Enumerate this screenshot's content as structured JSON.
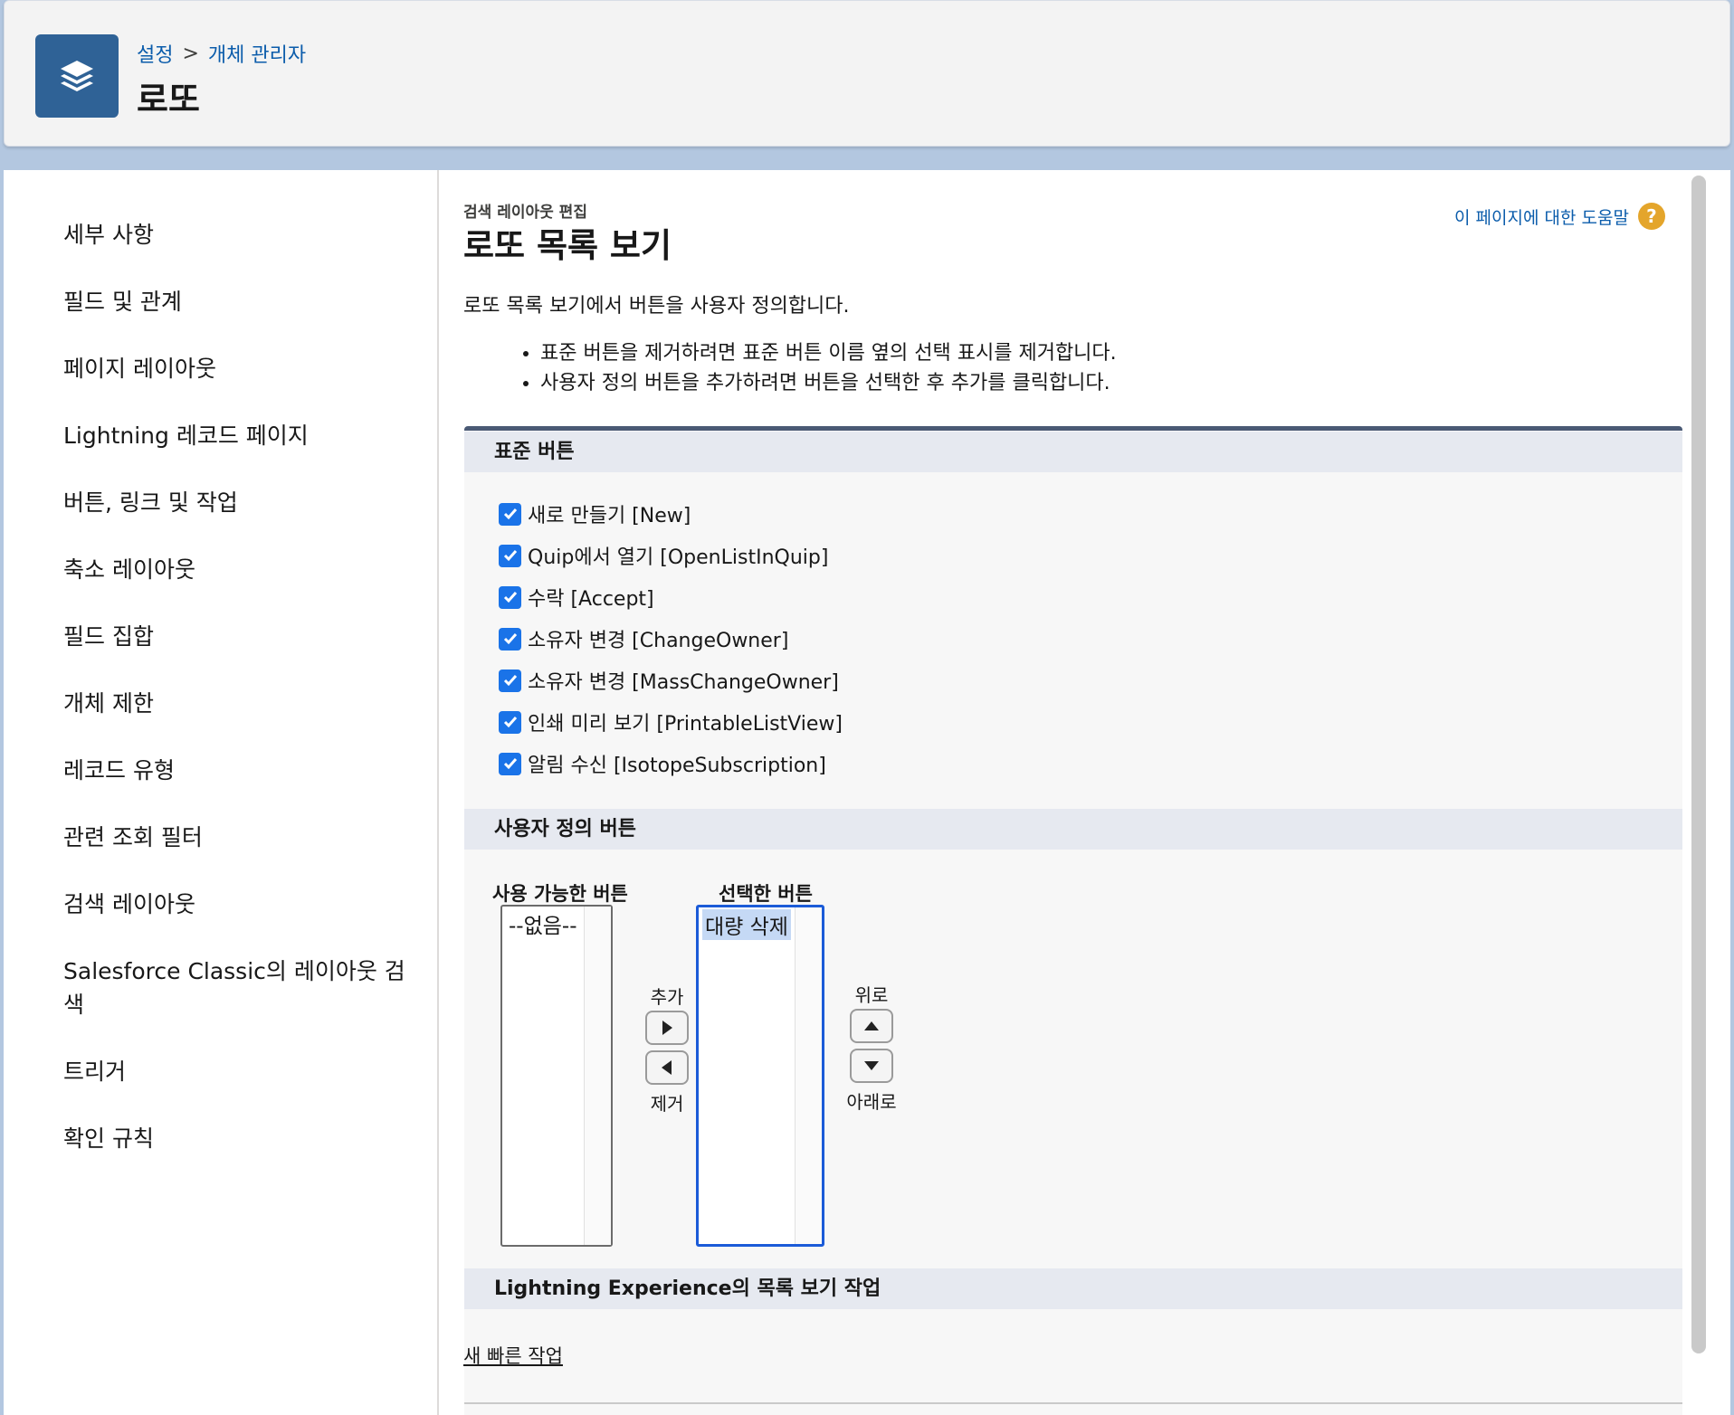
{
  "header": {
    "breadcrumb": [
      "설정",
      "개체 관리자"
    ],
    "breadcrumb_sep": ">",
    "title": "로또",
    "icon": "stack-layers-icon"
  },
  "sidebar": {
    "items": [
      "세부 사항",
      "필드 및 관계",
      "페이지 레이아웃",
      "Lightning 레코드 페이지",
      "버튼, 링크 및 작업",
      "축소 레이아웃",
      "필드 집합",
      "개체 제한",
      "레코드 유형",
      "관련 조회 필터",
      "검색 레이아웃",
      "Salesforce Classic의 레이아웃 검색",
      "트리거",
      "확인 규칙"
    ]
  },
  "content": {
    "page_type": "검색 레이아웃 편집",
    "page_title": "로또 목록 보기",
    "help_link": "이 페이지에 대한 도움말",
    "help_icon": "?",
    "description": "로또 목록 보기에서 버튼을 사용자 정의합니다.",
    "bullets": [
      "표준 버튼을 제거하려면 표준 버튼 이름 옆의 선택 표시를 제거합니다.",
      "사용자 정의 버튼을 추가하려면 버튼을 선택한 후 추가를 클릭합니다."
    ],
    "standard_buttons_header": "표준 버튼",
    "standard_buttons": [
      {
        "label": "새로 만들기 [New]",
        "checked": true
      },
      {
        "label": "Quip에서 열기 [OpenListInQuip]",
        "checked": true
      },
      {
        "label": "수락 [Accept]",
        "checked": true
      },
      {
        "label": "소유자 변경 [ChangeOwner]",
        "checked": true
      },
      {
        "label": "소유자 변경 [MassChangeOwner]",
        "checked": true
      },
      {
        "label": "인쇄 미리 보기 [PrintableListView]",
        "checked": true
      },
      {
        "label": "알림 수신 [IsotopeSubscription]",
        "checked": true
      }
    ],
    "custom_buttons_header": "사용자 정의 버튼",
    "available_label": "사용 가능한 버튼",
    "available_options": [
      "--없음--"
    ],
    "selected_label": "선택한 버튼",
    "selected_options": [
      "대량 삭제"
    ],
    "add_label": "추가",
    "remove_label": "제거",
    "up_label": "위로",
    "down_label": "아래로",
    "lightning_header": "Lightning Experience의 목록 보기 작업",
    "quick_action_link": "새 빠른 작업"
  },
  "colors": {
    "brand_icon_bg": "#2f6296",
    "link": "#0b5cab",
    "checkbox": "#1a73e8",
    "help_icon": "#e4a52b"
  }
}
